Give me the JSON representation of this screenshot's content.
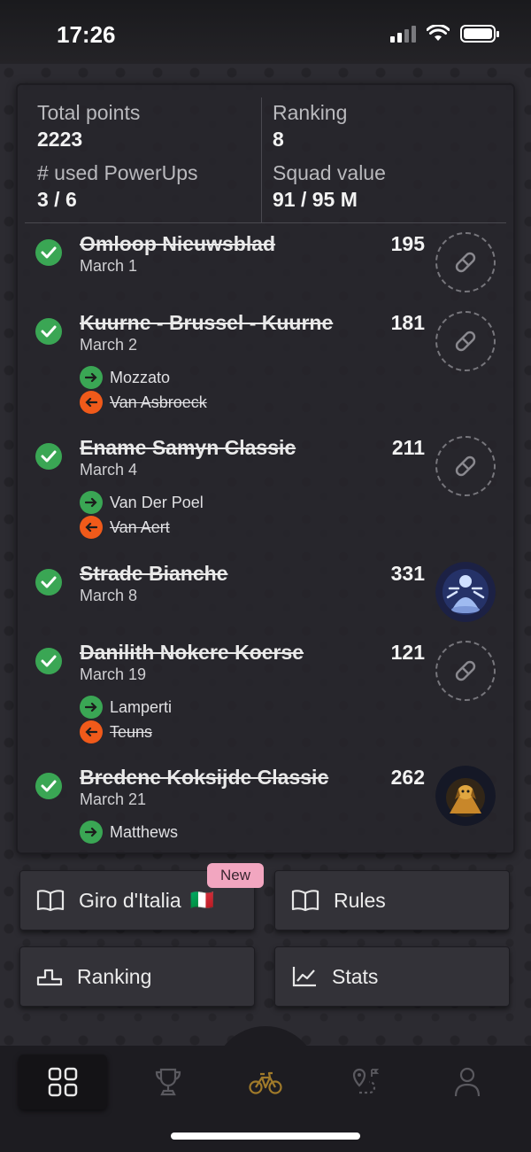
{
  "status_bar": {
    "time": "17:26"
  },
  "summary": {
    "total_points_label": "Total points",
    "total_points": "2223",
    "ranking_label": "Ranking",
    "ranking": "8",
    "powerups_label": "# used PowerUps",
    "powerups": "3 / 6",
    "squad_value_label": "Squad value",
    "squad_value": "91 / 95 M"
  },
  "races": [
    {
      "name": "Omloop Nieuwsblad",
      "date": "March 1",
      "points": "195"
    },
    {
      "name": "Kuurne - Brussel - Kuurne",
      "date": "March 2",
      "points": "181",
      "in": "Mozzato",
      "out": "Van Asbroeck"
    },
    {
      "name": "Ename Samyn Classic",
      "date": "March 4",
      "points": "211",
      "in": "Van Der Poel",
      "out": "Van Aert"
    },
    {
      "name": "Strade Bianche",
      "date": "March 8",
      "points": "331"
    },
    {
      "name": "Danilith Nokere Koerse",
      "date": "March 19",
      "points": "121",
      "in": "Lamperti",
      "out": "Teuns"
    },
    {
      "name": "Bredene Koksijde Classic",
      "date": "March 21",
      "points": "262",
      "in": "Matthews"
    }
  ],
  "buttons": {
    "giro": "Giro d'Italia",
    "giro_flag": "🇮🇹",
    "new_badge": "New",
    "rules": "Rules",
    "ranking": "Ranking",
    "stats": "Stats"
  },
  "colors": {
    "check_green": "#3aa654",
    "out_orange": "#f05a1a",
    "badge_pink": "#f2a6c0",
    "active_tab_icon": "#a07a2a"
  },
  "tabs": [
    "dashboard-icon",
    "trophy-icon",
    "bike-icon",
    "route-icon",
    "profile-icon"
  ]
}
